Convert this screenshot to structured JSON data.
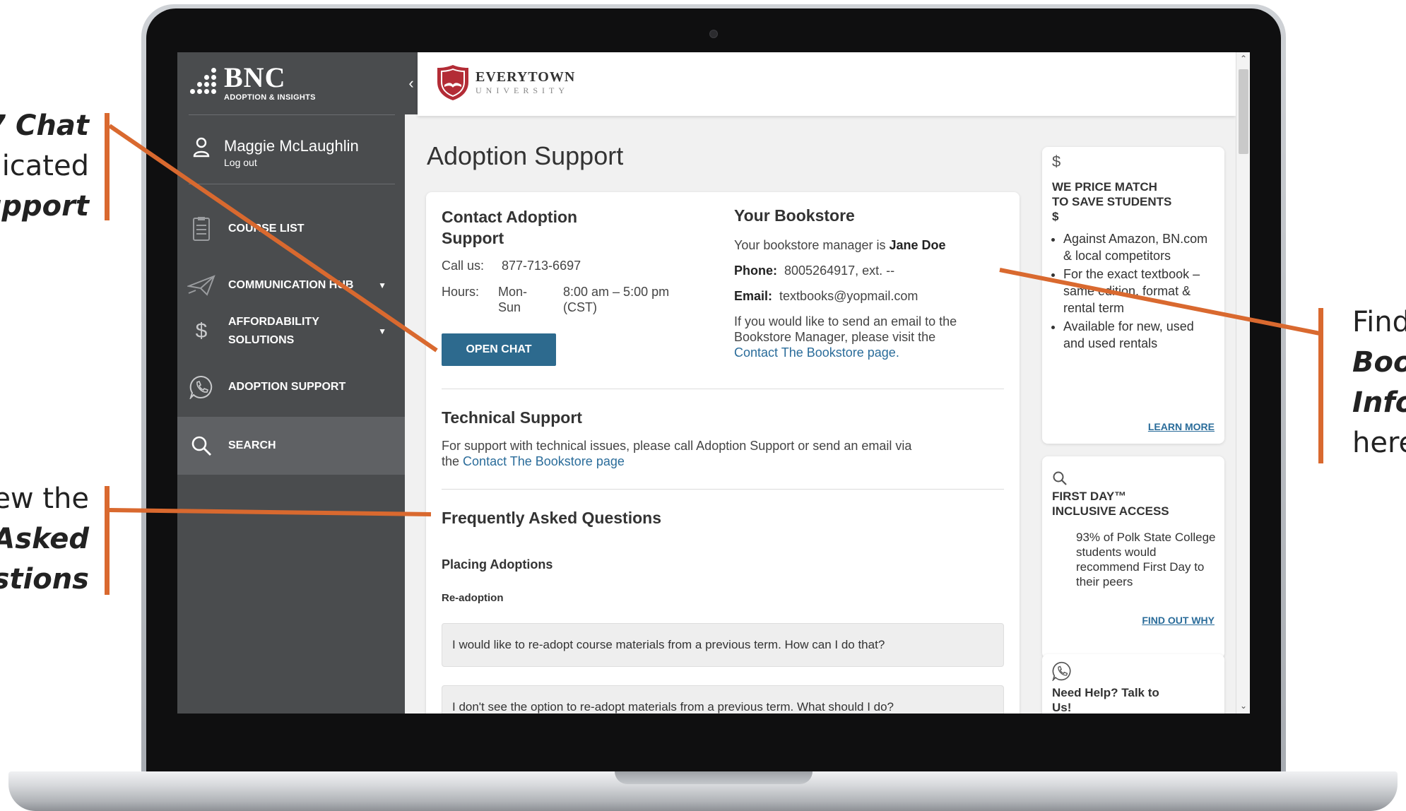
{
  "callouts": {
    "left_top_line1": "7 Chat",
    "left_top_line2": "licated",
    "left_top_line3": "upport",
    "left_bottom_line1": "ew the",
    "left_bottom_line2": "Asked",
    "left_bottom_line3": "estions",
    "right_line1": "Find",
    "right_line2": "Boo",
    "right_line3": "Info",
    "right_line4": "here",
    "accent_color": "#d9692f"
  },
  "sidebar": {
    "brand_name": "BNC",
    "brand_sub": "ADOPTION & INSIGHTS",
    "collapse_icon": "chevron-left-icon",
    "user_name": "Maggie McLaughlin",
    "logout": "Log out",
    "items": [
      {
        "label": "COURSE LIST",
        "icon": "clipboard-list-icon"
      },
      {
        "label": "COMMUNICATION HUB",
        "icon": "paper-plane-icon"
      },
      {
        "label": "AFFORDABILITY",
        "label2": "SOLUTIONS",
        "icon": "dollar-icon"
      },
      {
        "label": "ADOPTION SUPPORT",
        "icon": "chat-phone-icon"
      },
      {
        "label": "SEARCH",
        "icon": "search-icon"
      }
    ]
  },
  "header": {
    "logo_line1": "EVERYTOWN",
    "logo_line2": "UNIVERSITY"
  },
  "page": {
    "title": "Adoption Support",
    "contact": {
      "heading_line1": "Contact Adoption",
      "heading_line2": "Support",
      "call_label": "Call us:",
      "phone": "877-713-6697",
      "hours_label": "Hours:",
      "days_line1": "Mon-",
      "days_line2": "Sun",
      "time_line1": "8:00 am – 5:00 pm",
      "time_line2": "(CST)",
      "chat_button": "OPEN CHAT"
    },
    "bookstore": {
      "heading": "Your Bookstore",
      "manager_prefix": "Your bookstore manager is",
      "manager_name": "Jane Doe",
      "phone_label": "Phone:",
      "phone": "8005264917, ext. --",
      "email_label": "Email:",
      "email": "textbooks@yopmail.com",
      "note_line1": "If you would like to send an email to the",
      "note_line2": "Bookstore Manager, please visit the",
      "note_link": "Contact The Bookstore page."
    },
    "technical": {
      "heading": "Technical Support",
      "text_line1": "For support with technical issues, please call Adoption Support or send an email via",
      "text_prefix": "the",
      "text_link": "Contact The Bookstore page"
    },
    "faq": {
      "heading": "Frequently Asked Questions",
      "subheading": "Placing Adoptions",
      "section": "Re-adoption",
      "items": [
        "I would like to re-adopt course materials from a previous term. How can I do that?",
        "I don't see the option to re-adopt materials from a previous term. What should I do?"
      ]
    }
  },
  "rail": {
    "price_match": {
      "icon": "dollar-icon",
      "title_line1": "WE PRICE MATCH",
      "title_line2": "TO SAVE STUDENTS",
      "title_line3": "$",
      "bullets": [
        "Against Amazon, BN.com & local competitors",
        "For the exact textbook – same edition, format & rental term",
        "Available for new, used and used rentals"
      ],
      "link": "LEARN MORE"
    },
    "first_day": {
      "icon": "search-icon",
      "title_line1": "FIRST DAY™",
      "title_line2": "INCLUSIVE ACCESS",
      "text": "93% of Polk State College students would recommend First Day to their peers",
      "link": "FIND OUT WHY"
    },
    "help": {
      "icon": "chat-phone-icon",
      "title_line1": "Need Help? Talk to",
      "title_line2": "Us!"
    }
  }
}
